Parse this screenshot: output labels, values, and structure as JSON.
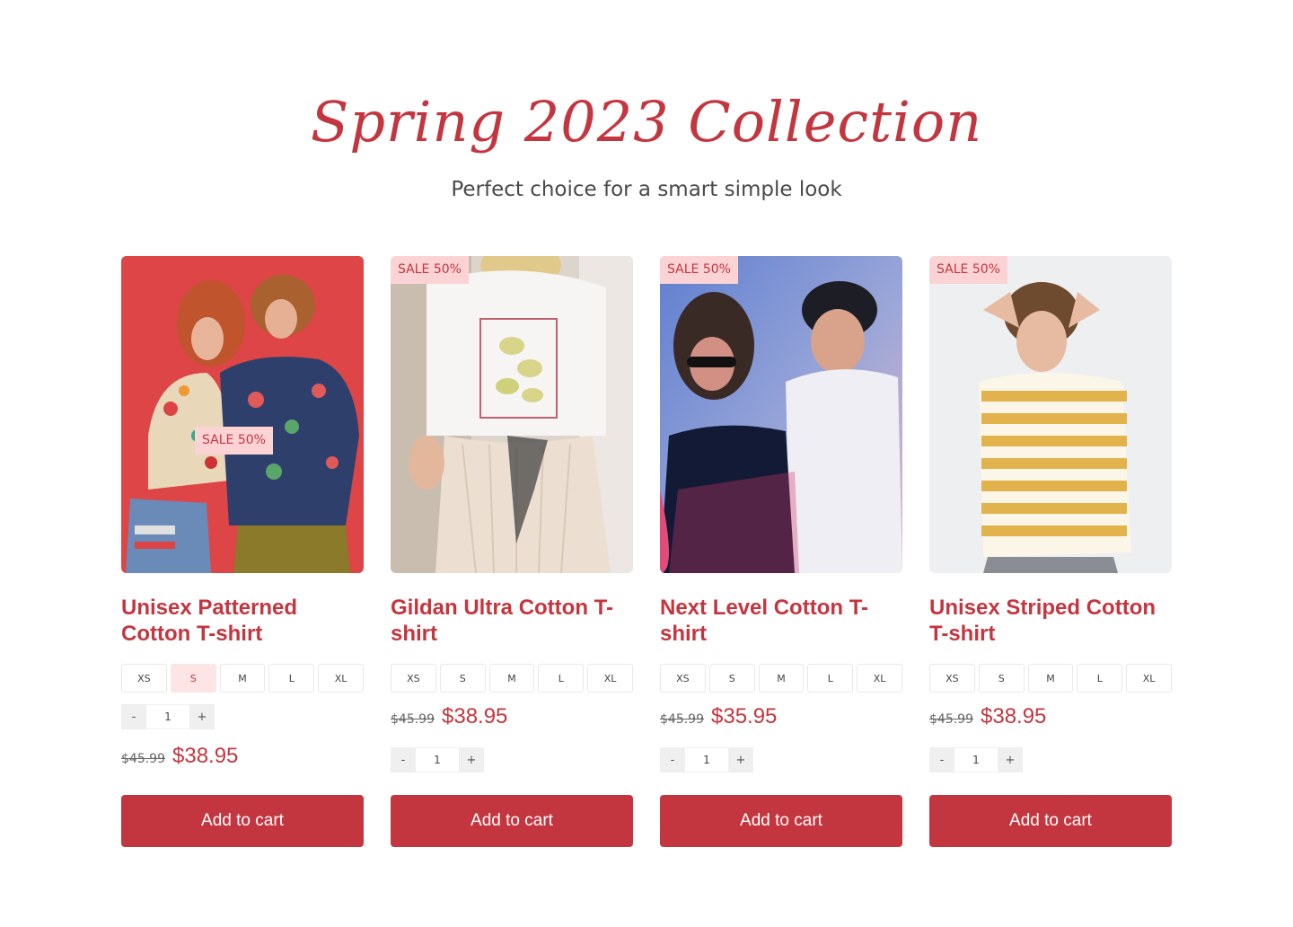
{
  "header": {
    "title": "Spring 2023 Collection",
    "subtitle": "Perfect choice for a smart simple look"
  },
  "colors": {
    "accent": "#c4363f",
    "badge_bg": "#fbd3d5",
    "active_size_bg": "#fde4e5"
  },
  "products": [
    {
      "name": "Unisex Patterned Cotton T-shirt",
      "badge": "SALE 50%",
      "sizes": [
        "XS",
        "S",
        "M",
        "L",
        "XL"
      ],
      "selected_size": "S",
      "quantity": "1",
      "old_price": "$45.99",
      "price": "$38.95",
      "cta": "Add to cart",
      "qty_minus": "-",
      "qty_plus": "+"
    },
    {
      "name": "Gildan Ultra Cotton T-shirt",
      "badge": "SALE 50%",
      "sizes": [
        "XS",
        "S",
        "M",
        "L",
        "XL"
      ],
      "quantity": "1",
      "old_price": "$45.99",
      "price": "$38.95",
      "cta": "Add to cart",
      "qty_minus": "-",
      "qty_plus": "+"
    },
    {
      "name": "Next Level Cotton T-shirt",
      "badge": "SALE 50%",
      "sizes": [
        "XS",
        "S",
        "M",
        "L",
        "XL"
      ],
      "quantity": "1",
      "old_price": "$45.99",
      "price": "$35.95",
      "cta": "Add to cart",
      "qty_minus": "-",
      "qty_plus": "+"
    },
    {
      "name": "Unisex Striped Cotton T-shirt",
      "badge": "SALE 50%",
      "sizes": [
        "XS",
        "S",
        "M",
        "L",
        "XL"
      ],
      "quantity": "1",
      "old_price": "$45.99",
      "price": "$38.95",
      "cta": "Add to cart",
      "qty_minus": "-",
      "qty_plus": "+"
    }
  ]
}
